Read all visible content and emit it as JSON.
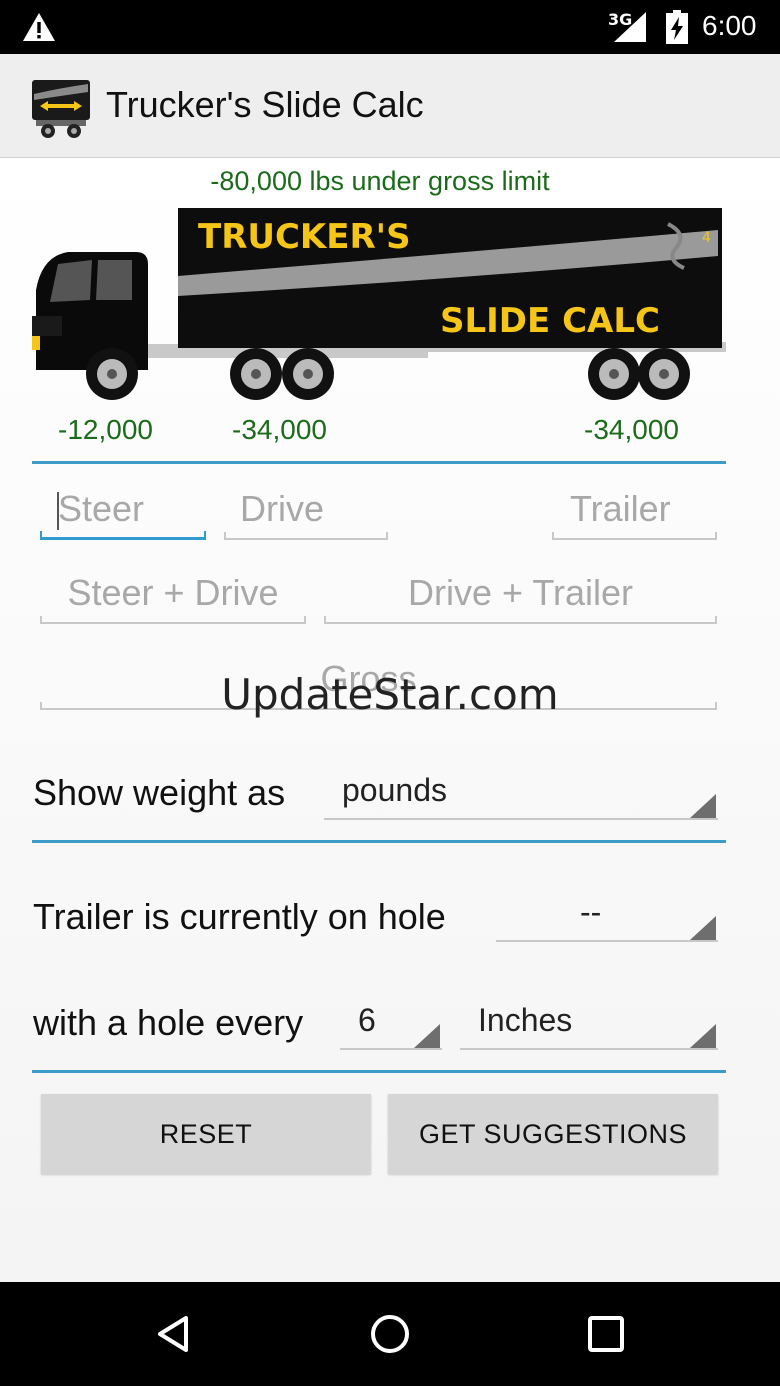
{
  "status_bar": {
    "network": "3G",
    "time": "6:00"
  },
  "app_bar": {
    "title": "Trucker's Slide Calc"
  },
  "summary": {
    "gross_status": "-80,000 lbs under gross limit"
  },
  "truck_graphic": {
    "line1": "TRUCKER'S",
    "line2": "SLIDE CALC",
    "badge": "4"
  },
  "axle_weights": {
    "steer": "-12,000",
    "drive": "-34,000",
    "trailer": "-34,000"
  },
  "inputs": {
    "steer": {
      "placeholder": "Steer",
      "value": ""
    },
    "drive": {
      "placeholder": "Drive",
      "value": ""
    },
    "trailer": {
      "placeholder": "Trailer",
      "value": ""
    },
    "steer_drive": {
      "placeholder": "Steer + Drive",
      "value": ""
    },
    "drive_trailer": {
      "placeholder": "Drive + Trailer",
      "value": ""
    },
    "gross": {
      "placeholder": "Gross",
      "value": ""
    }
  },
  "watermark": "UpdateStar.com",
  "settings": {
    "weight_label": "Show weight as",
    "weight_unit": "pounds",
    "hole_label": "Trailer is currently on hole",
    "hole_value": "--",
    "spacing_label": "with a hole every",
    "spacing_value": "6",
    "spacing_unit": "Inches"
  },
  "buttons": {
    "reset": "RESET",
    "suggestions": "GET SUGGESTIONS"
  },
  "colors": {
    "accent": "#3a9cc7",
    "positive_text": "#1b6b1b",
    "truck_gold": "#f5c518"
  }
}
